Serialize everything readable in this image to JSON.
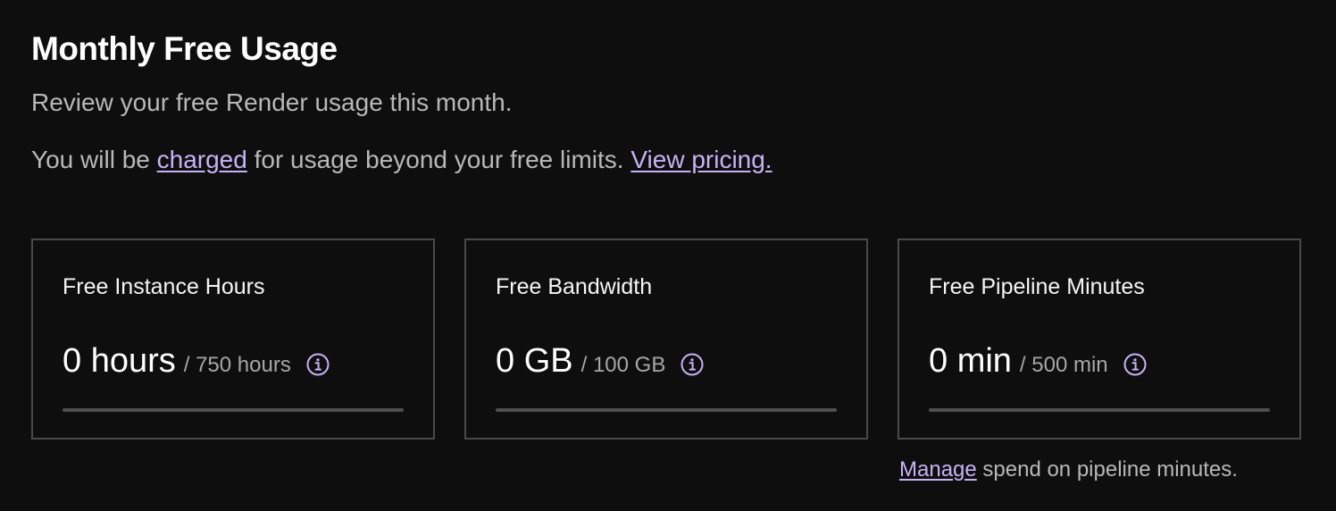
{
  "header": {
    "title": "Monthly Free Usage",
    "subtitle": "Review your free Render usage this month."
  },
  "charge_notice": {
    "prefix": "You will be ",
    "charged_link": "charged",
    "middle": " for usage beyond your free limits. ",
    "pricing_link": "View pricing."
  },
  "cards": [
    {
      "label": "Free Instance Hours",
      "value": "0 hours",
      "limit": "/ 750 hours",
      "used_fraction": 0,
      "icon": "info-icon"
    },
    {
      "label": "Free Bandwidth",
      "value": "0 GB",
      "limit": "/ 100 GB",
      "used_fraction": 0,
      "icon": "info-icon"
    },
    {
      "label": "Free Pipeline Minutes",
      "value": "0 min",
      "limit": "/ 500 min",
      "used_fraction": 0,
      "icon": "info-icon"
    }
  ],
  "footer": {
    "manage_link": "Manage",
    "text": " spend on pipeline minutes."
  },
  "colors": {
    "background": "#0e0e0f",
    "accent": "#c6b3f5",
    "border": "#4a4a4d",
    "muted_text": "#b8b8b8"
  }
}
